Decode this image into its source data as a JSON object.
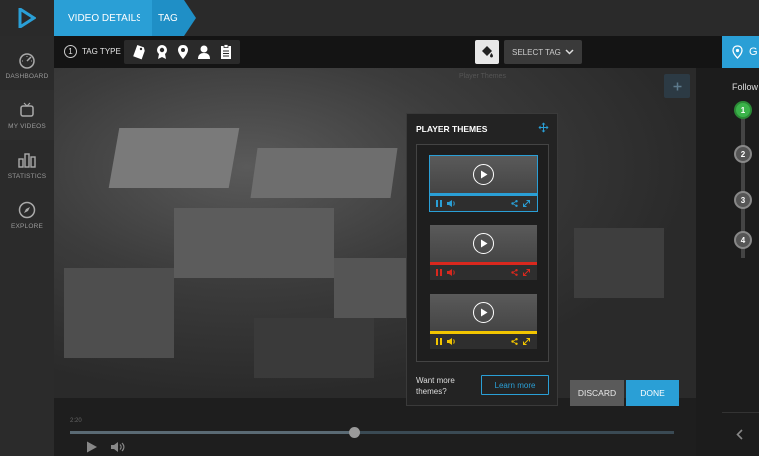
{
  "breadcrumbs": [
    {
      "label": "VIDEO DETAILS"
    },
    {
      "label": "TAG"
    }
  ],
  "sidebar": {
    "items": [
      {
        "label": "DASHBOARD",
        "icon": "dashboard-icon"
      },
      {
        "label": "MY VIDEOS",
        "icon": "tv-icon"
      },
      {
        "label": "STATISTICS",
        "icon": "bar-chart-icon"
      },
      {
        "label": "EXPLORE",
        "icon": "compass-icon"
      }
    ]
  },
  "toolbar": {
    "step": "1",
    "tag_type_label": "TAG TYPE",
    "tag_icons": [
      "price-tag-icon",
      "badge-icon",
      "location-pin-icon",
      "person-icon",
      "clipboard-icon"
    ],
    "select_tag_label": "SELECT TAG"
  },
  "video": {
    "caption": "Player Themes",
    "time": "2:20",
    "progress": 0.47
  },
  "themes_panel": {
    "title": "PLAYER THEMES",
    "themes": [
      {
        "accent": "#2a9fd6",
        "selected": true
      },
      {
        "accent": "#d9281e",
        "selected": false
      },
      {
        "accent": "#f2c500",
        "selected": false
      }
    ],
    "want_more": "Want more themes?",
    "learn_more": "Learn more"
  },
  "actions": {
    "discard": "DISCARD",
    "done": "DONE"
  },
  "guide": {
    "title": "G",
    "follow": "Follow",
    "steps": [
      "1",
      "2",
      "3",
      "4"
    ]
  },
  "colors": {
    "accent": "#2a9fd6",
    "step_active": "#3bb34a"
  }
}
